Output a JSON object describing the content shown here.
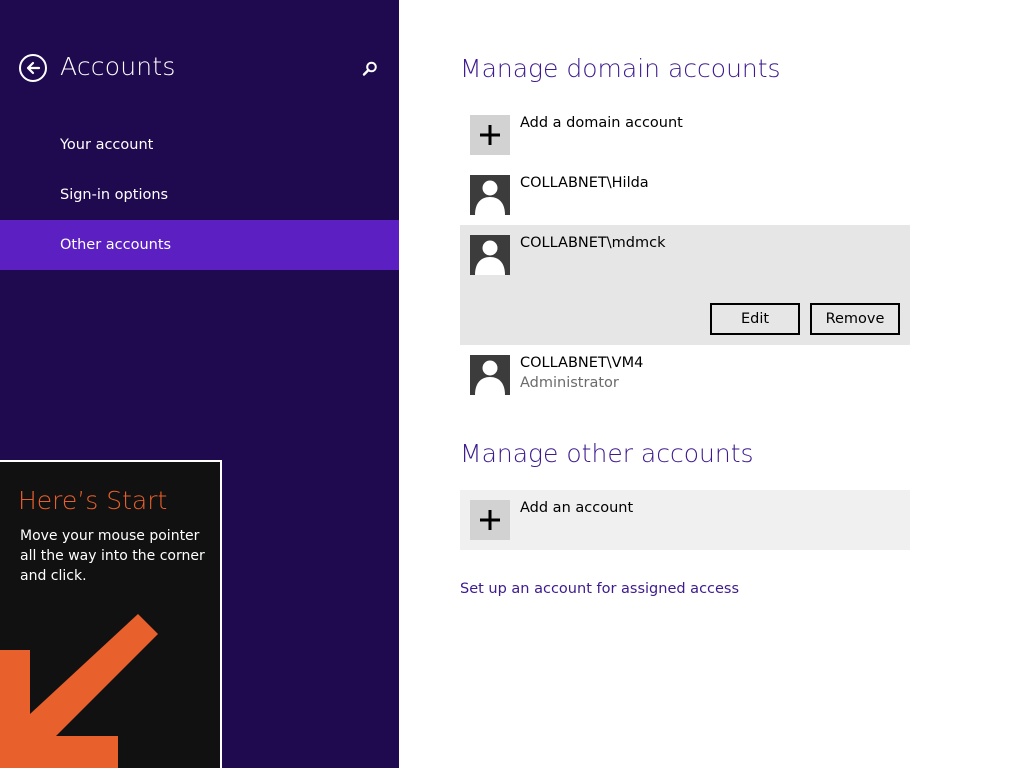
{
  "sidebar": {
    "title": "Accounts",
    "items": [
      {
        "label": "Your account",
        "selected": false
      },
      {
        "label": "Sign-in options",
        "selected": false
      },
      {
        "label": "Other accounts",
        "selected": true
      }
    ]
  },
  "start_tip": {
    "title": "Here’s Start",
    "body": "Move your mouse pointer all the way into the corner and click."
  },
  "domain_section": {
    "title": "Manage domain accounts",
    "add_label": "Add a domain account",
    "accounts": [
      {
        "name": "COLLABNET\\Hilda",
        "role": ""
      },
      {
        "name": "COLLABNET\\mdmck",
        "role": "",
        "expanded": true
      },
      {
        "name": "COLLABNET\\VM4",
        "role": "Administrator"
      }
    ],
    "edit_label": "Edit",
    "remove_label": "Remove"
  },
  "other_section": {
    "title": "Manage other accounts",
    "add_label": "Add an account"
  },
  "assigned_access_link": "Set up an account for assigned access",
  "colors": {
    "sidebar_bg": "#1f0a4f",
    "selected_nav": "#5b1fc2",
    "accent_text": "#3d1a8e",
    "tip_accent": "#e8602c"
  },
  "icons": [
    "back-arrow-icon",
    "search-icon",
    "plus-icon",
    "user-icon",
    "arrow-down-left-icon"
  ]
}
